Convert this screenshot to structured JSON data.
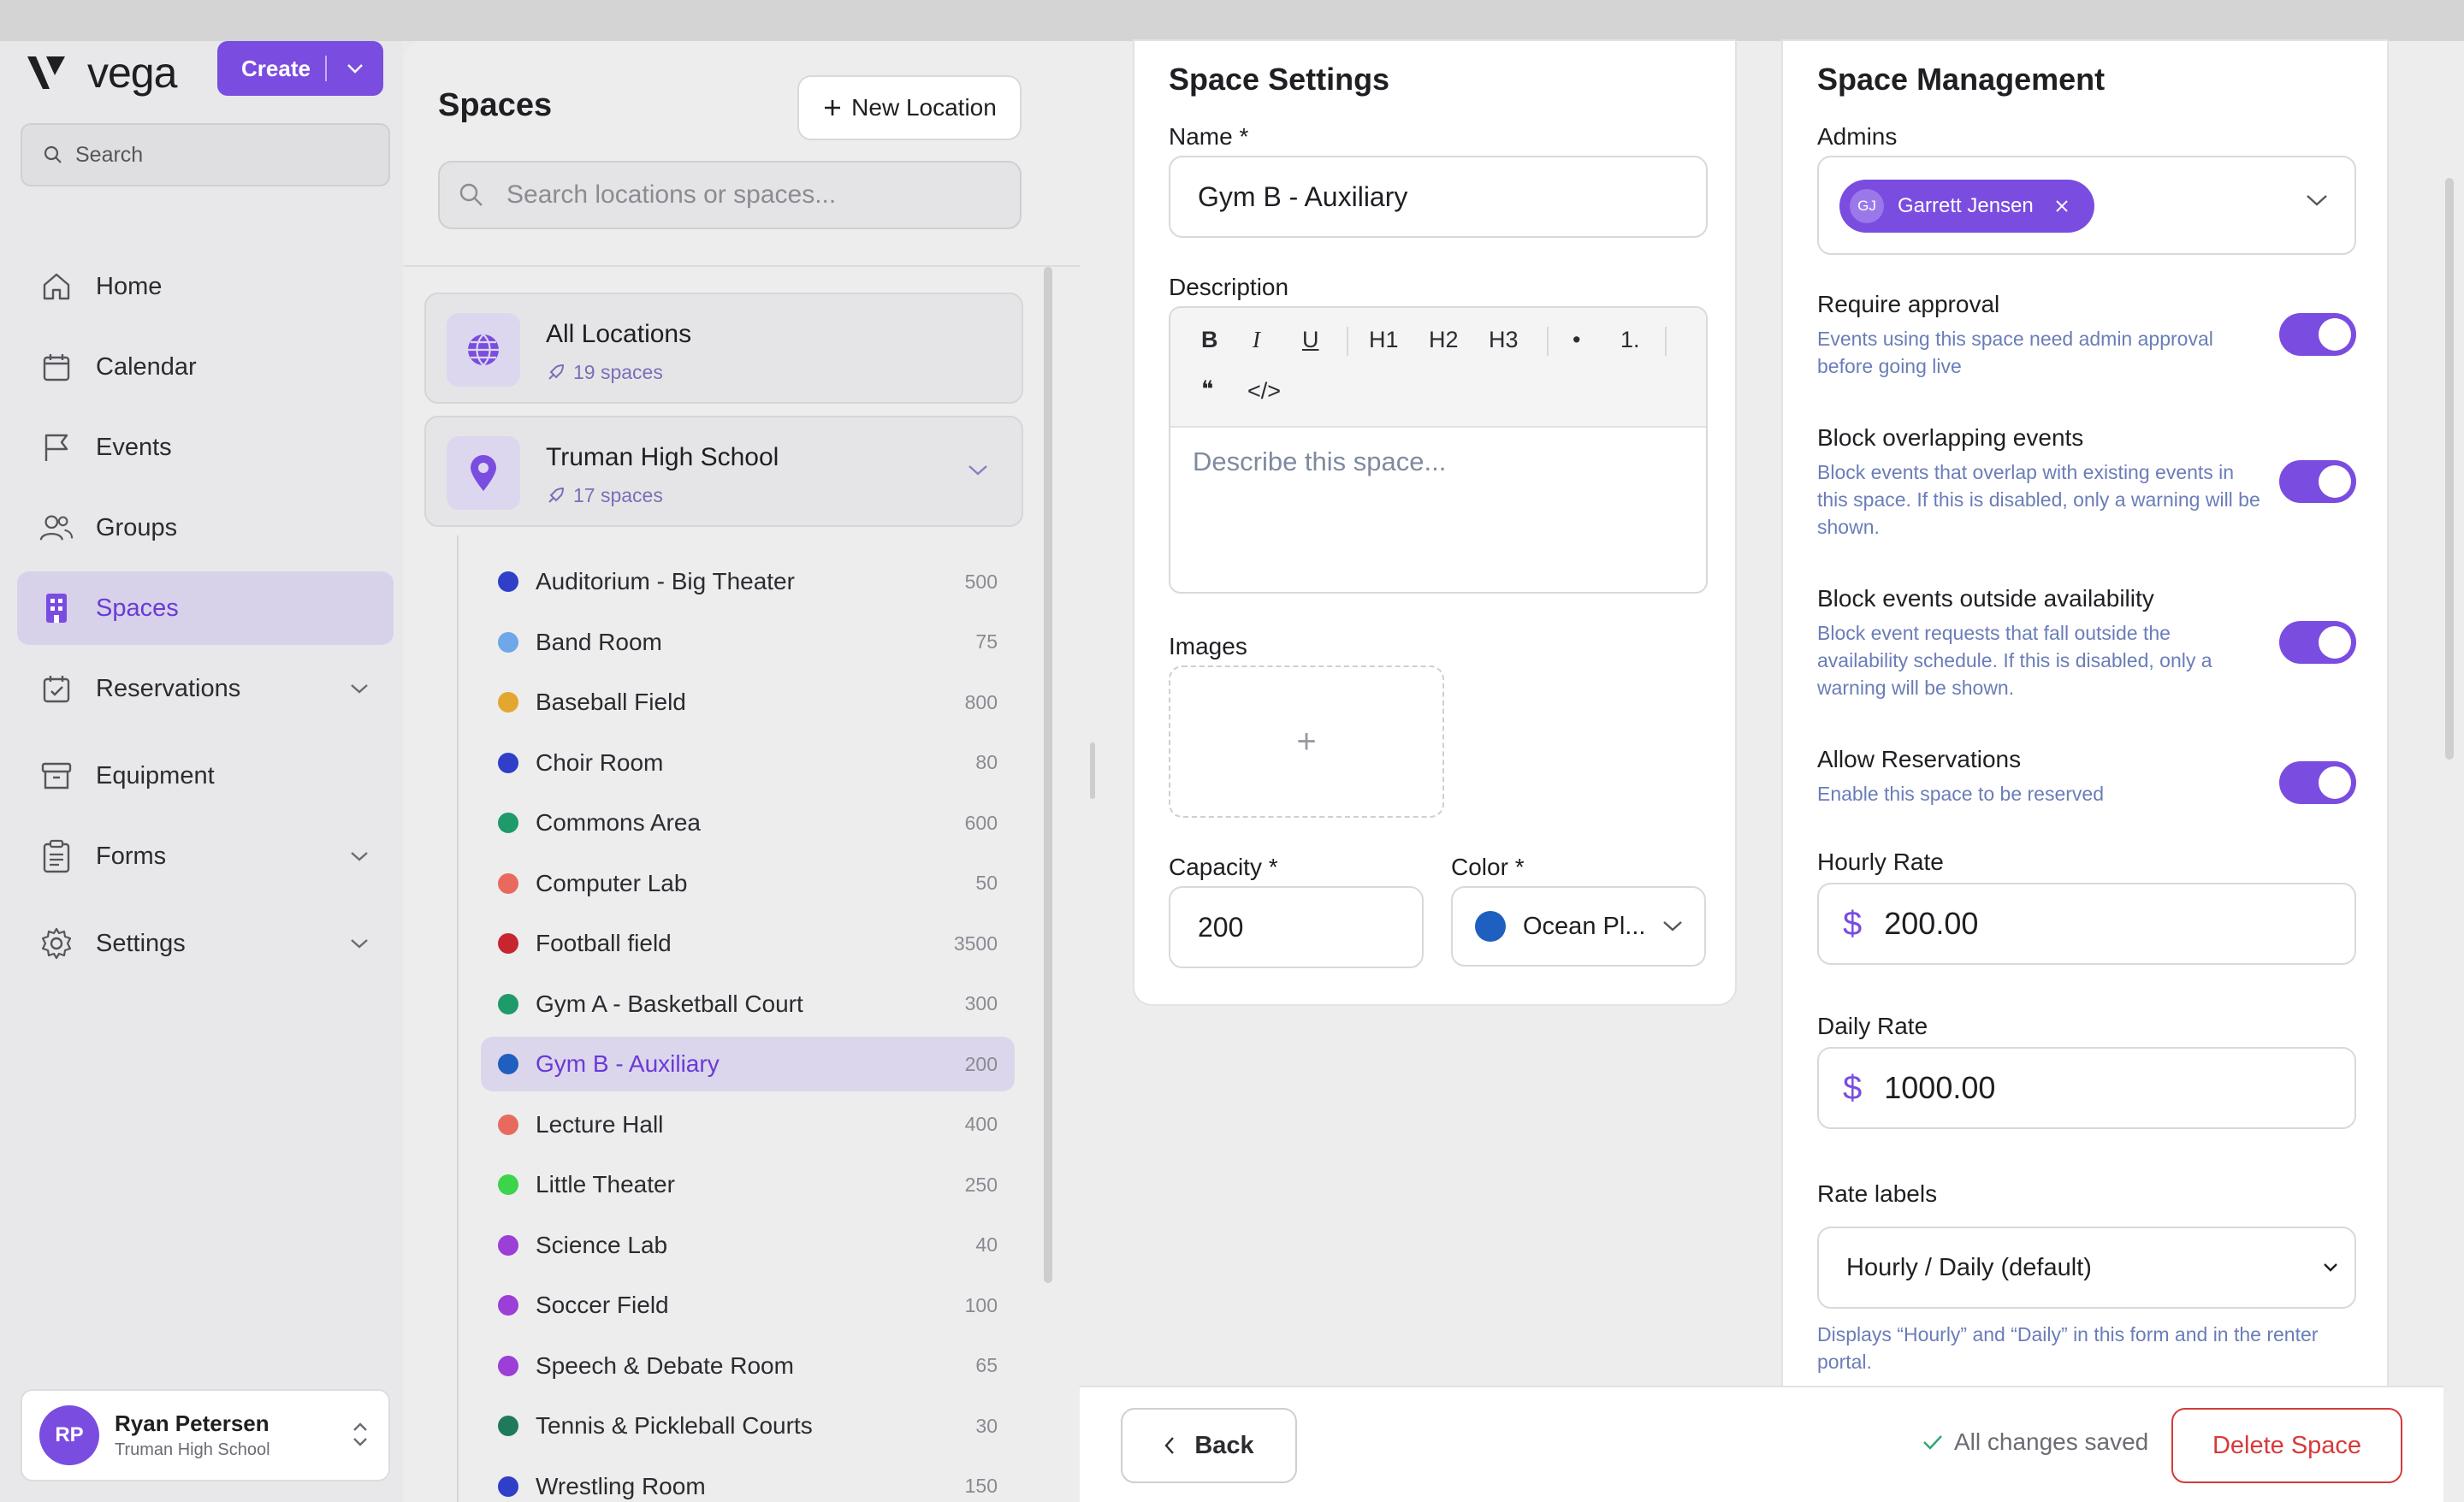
{
  "app": {
    "name": "vega",
    "create_label": "Create"
  },
  "sidebar": {
    "search_placeholder": "Search",
    "items": [
      {
        "label": "Home",
        "icon": "home-icon",
        "active": false,
        "expandable": false
      },
      {
        "label": "Calendar",
        "icon": "calendar-icon",
        "active": false,
        "expandable": false
      },
      {
        "label": "Events",
        "icon": "flag-icon",
        "active": false,
        "expandable": false
      },
      {
        "label": "Groups",
        "icon": "users-icon",
        "active": false,
        "expandable": false
      },
      {
        "label": "Spaces",
        "icon": "building-icon",
        "active": true,
        "expandable": false
      },
      {
        "label": "Reservations",
        "icon": "calendar-check-icon",
        "active": false,
        "expandable": true
      },
      {
        "label": "Equipment",
        "icon": "archive-icon",
        "active": false,
        "expandable": false
      },
      {
        "label": "Forms",
        "icon": "clipboard-icon",
        "active": false,
        "expandable": true
      },
      {
        "label": "Settings",
        "icon": "gear-icon",
        "active": false,
        "expandable": true
      }
    ],
    "user": {
      "initials": "RP",
      "name": "Ryan Petersen",
      "org": "Truman High School"
    }
  },
  "spaces_panel": {
    "title": "Spaces",
    "new_location_label": "New Location",
    "search_placeholder": "Search locations or spaces...",
    "all_locations": {
      "name": "All Locations",
      "count": "19 spaces"
    },
    "location": {
      "name": "Truman High School",
      "count": "17 spaces"
    },
    "spaces": [
      {
        "name": "Auditorium - Big Theater",
        "capacity": "500",
        "color": "#2f3fc7",
        "active": false
      },
      {
        "name": "Band Room",
        "capacity": "75",
        "color": "#6ea8e8",
        "active": false
      },
      {
        "name": "Baseball Field",
        "capacity": "800",
        "color": "#e3a72f",
        "active": false
      },
      {
        "name": "Choir Room",
        "capacity": "80",
        "color": "#2f3fc7",
        "active": false
      },
      {
        "name": "Commons Area",
        "capacity": "600",
        "color": "#1f9a6a",
        "active": false
      },
      {
        "name": "Computer Lab",
        "capacity": "50",
        "color": "#e86a5f",
        "active": false
      },
      {
        "name": "Football field",
        "capacity": "3500",
        "color": "#c8262e",
        "active": false
      },
      {
        "name": "Gym A - Basketball Court",
        "capacity": "300",
        "color": "#1f9a6a",
        "active": false
      },
      {
        "name": "Gym B - Auxiliary",
        "capacity": "200",
        "color": "#1e5fbf",
        "active": true
      },
      {
        "name": "Lecture Hall",
        "capacity": "400",
        "color": "#e86a5f",
        "active": false
      },
      {
        "name": "Little Theater",
        "capacity": "250",
        "color": "#3bd44a",
        "active": false
      },
      {
        "name": "Science Lab",
        "capacity": "40",
        "color": "#9b3fd6",
        "active": false
      },
      {
        "name": "Soccer Field",
        "capacity": "100",
        "color": "#9b3fd6",
        "active": false
      },
      {
        "name": "Speech & Debate Room",
        "capacity": "65",
        "color": "#9b3fd6",
        "active": false
      },
      {
        "name": "Tennis & Pickleball Courts",
        "capacity": "30",
        "color": "#1f7a5a",
        "active": false
      },
      {
        "name": "Wrestling Room",
        "capacity": "150",
        "color": "#2f3fc7",
        "active": false
      }
    ]
  },
  "settings": {
    "title": "Space Settings",
    "name_label": "Name *",
    "name_value": "Gym B - Auxiliary",
    "description_label": "Description",
    "toolbar": {
      "bold": "B",
      "italic": "I",
      "underline": "U",
      "h1": "H1",
      "h2": "H2",
      "h3": "H3",
      "bullet": "•",
      "ordered": "1.",
      "quote": "❝",
      "code": "</>"
    },
    "description_placeholder": "Describe this space...",
    "images_label": "Images",
    "add_image": "+",
    "capacity_label": "Capacity *",
    "capacity_value": "200",
    "color_label": "Color *",
    "color_value": "Ocean Pl...",
    "color_swatch": "#1e5fbf"
  },
  "management": {
    "title": "Space Management",
    "admins_label": "Admins",
    "admin": {
      "initials": "GJ",
      "name": "Garrett Jensen"
    },
    "toggles": [
      {
        "title": "Require approval",
        "desc": "Events using this space need admin approval before going live",
        "on": true
      },
      {
        "title": "Block overlapping events",
        "desc": "Block events that overlap with existing events in this space. If this is disabled, only a warning will be shown.",
        "on": true
      },
      {
        "title": "Block events outside availability",
        "desc": "Block event requests that fall outside the availability schedule. If this is disabled, only a warning will be shown.",
        "on": true
      },
      {
        "title": "Allow Reservations",
        "desc": "Enable this space to be reserved",
        "on": true
      }
    ],
    "hourly_label": "Hourly Rate",
    "hourly_value": "200.00",
    "daily_label": "Daily Rate",
    "daily_value": "1000.00",
    "currency_symbol": "$",
    "rate_labels_label": "Rate labels",
    "rate_labels_value": "Hourly / Daily (default)",
    "rate_labels_hint": "Displays “Hourly” and “Daily” in this form and in the renter portal."
  },
  "footer": {
    "back_label": "Back",
    "saved_label": "All changes saved",
    "delete_label": "Delete Space"
  },
  "colors": {
    "accent": "#7a4ce0",
    "danger": "#d63a3a",
    "hint": "#6a7db8"
  }
}
